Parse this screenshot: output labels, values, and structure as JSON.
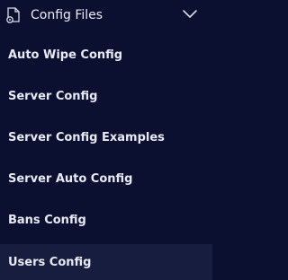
{
  "section": {
    "title": "Config Files",
    "icon": "gear-file-icon",
    "toggle_icon": "chevron-down-icon"
  },
  "menu": {
    "items": [
      {
        "label": "Auto Wipe Config"
      },
      {
        "label": "Server Config"
      },
      {
        "label": "Server Config Examples"
      },
      {
        "label": "Server Auto Config"
      },
      {
        "label": "Bans Config"
      },
      {
        "label": "Users Config",
        "active": true
      }
    ]
  },
  "colors": {
    "background": "#0b1030",
    "active_background": "#171d3e",
    "text": "#e7e9f3"
  }
}
